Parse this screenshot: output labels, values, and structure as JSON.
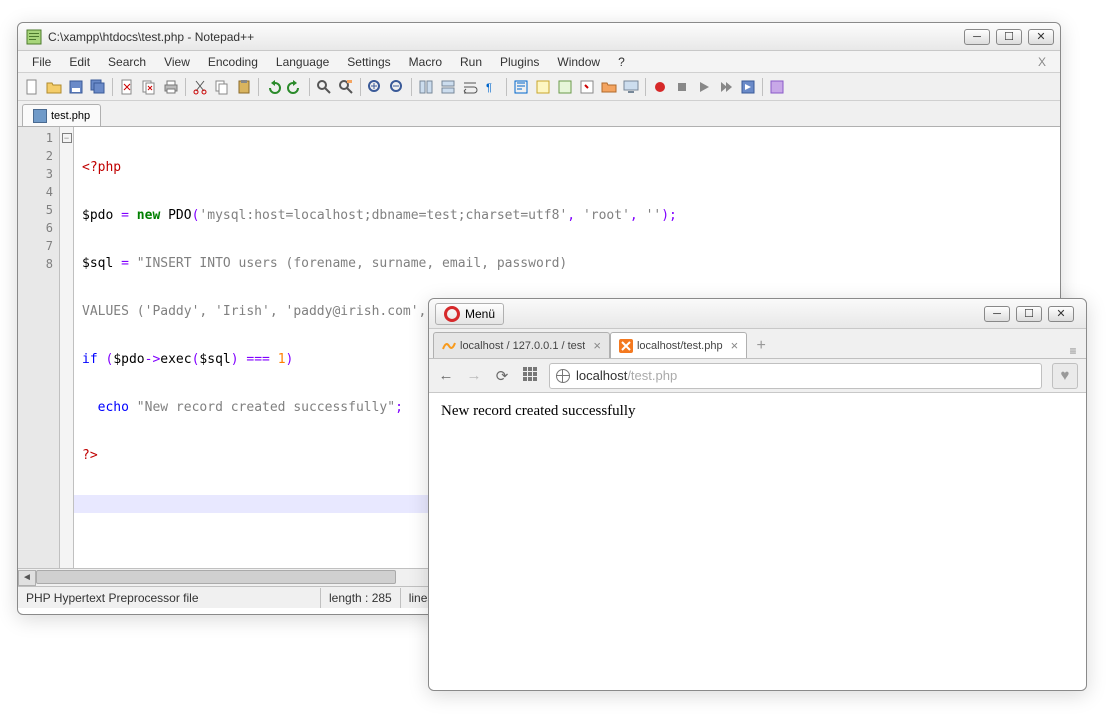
{
  "npp": {
    "title": "C:\\xampp\\htdocs\\test.php - Notepad++",
    "menu": [
      "File",
      "Edit",
      "Search",
      "View",
      "Encoding",
      "Language",
      "Settings",
      "Macro",
      "Run",
      "Plugins",
      "Window",
      "?"
    ],
    "tab": "test.php",
    "code_lines_count": 8,
    "code": {
      "l1": {
        "open": "<?php"
      },
      "l2": {
        "a": "$pdo ",
        "b": "= ",
        "c": "new ",
        "d": "PDO",
        "e": "(",
        "f": "'mysql:host=localhost;dbname=test;charset=utf8'",
        "g": ", ",
        "h": "'root'",
        "i": ", ",
        "j": "''",
        "k": ");"
      },
      "l3": {
        "a": "$sql ",
        "b": "= ",
        "c": "\"INSERT INTO users (forename, surname, email, password)"
      },
      "l4": {
        "a": "VALUES ('Paddy', 'Irish', 'paddy@irish.com', 'qaywsx')\"",
        "b": ";"
      },
      "l5": {
        "a": "if ",
        "b": "(",
        "c": "$pdo",
        "d": "->",
        "e": "exec",
        "f": "(",
        "g": "$sql",
        "h": ") ",
        "i": "=== ",
        "j": "1",
        "k": ")"
      },
      "l6": {
        "a": "  ",
        "b": "echo ",
        "c": "\"New record created successfully\"",
        "d": ";"
      },
      "l7": {
        "close": "?>"
      }
    },
    "status": {
      "lang": "PHP Hypertext Preprocessor file",
      "len": "length : 285",
      "lines": "lines :"
    }
  },
  "opera": {
    "menu_label": "Menü",
    "tabs": [
      {
        "label": "localhost / 127.0.0.1 / test"
      },
      {
        "label": "localhost/test.php"
      }
    ],
    "url_host": "localhost",
    "url_path": "/test.php",
    "page_text": "New record created successfully"
  }
}
